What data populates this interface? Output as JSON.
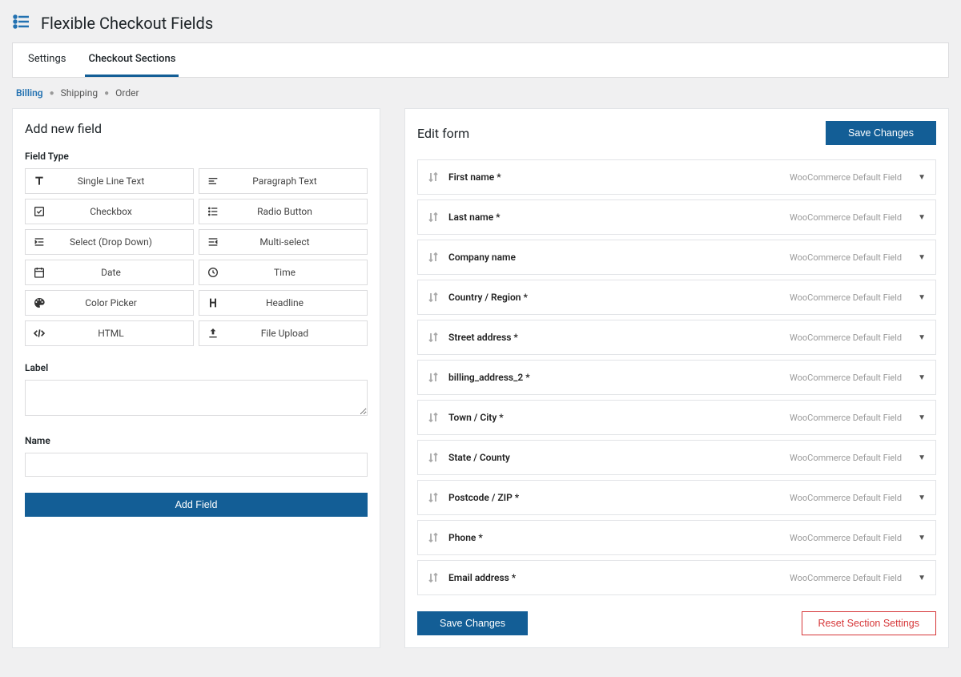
{
  "page_title": "Flexible Checkout Fields",
  "tabs": [
    {
      "label": "Settings",
      "active": false
    },
    {
      "label": "Checkout Sections",
      "active": true
    }
  ],
  "sub_sections": [
    {
      "label": "Billing",
      "active": true
    },
    {
      "label": "Shipping",
      "active": false
    },
    {
      "label": "Order",
      "active": false
    }
  ],
  "left": {
    "title": "Add new field",
    "field_type_label": "Field Type",
    "types": [
      {
        "label": "Single Line Text",
        "icon": "text"
      },
      {
        "label": "Paragraph Text",
        "icon": "align-left"
      },
      {
        "label": "Checkbox",
        "icon": "checkbox"
      },
      {
        "label": "Radio Button",
        "icon": "list"
      },
      {
        "label": "Select (Drop Down)",
        "icon": "indent"
      },
      {
        "label": "Multi-select",
        "icon": "indent-right"
      },
      {
        "label": "Date",
        "icon": "calendar"
      },
      {
        "label": "Time",
        "icon": "clock"
      },
      {
        "label": "Color Picker",
        "icon": "palette"
      },
      {
        "label": "Headline",
        "icon": "heading"
      },
      {
        "label": "HTML",
        "icon": "code"
      },
      {
        "label": "File Upload",
        "icon": "upload"
      }
    ],
    "label_label": "Label",
    "name_label": "Name",
    "add_button": "Add Field"
  },
  "right": {
    "title": "Edit form",
    "save_button": "Save Changes",
    "reset_button": "Reset Section Settings",
    "default_meta": "WooCommerce Default Field",
    "rows": [
      {
        "label": "First name *"
      },
      {
        "label": "Last name *"
      },
      {
        "label": "Company name"
      },
      {
        "label": "Country / Region *"
      },
      {
        "label": "Street address *"
      },
      {
        "label": "billing_address_2 *"
      },
      {
        "label": "Town / City *"
      },
      {
        "label": "State / County"
      },
      {
        "label": "Postcode / ZIP *"
      },
      {
        "label": "Phone *"
      },
      {
        "label": "Email address *"
      }
    ]
  }
}
